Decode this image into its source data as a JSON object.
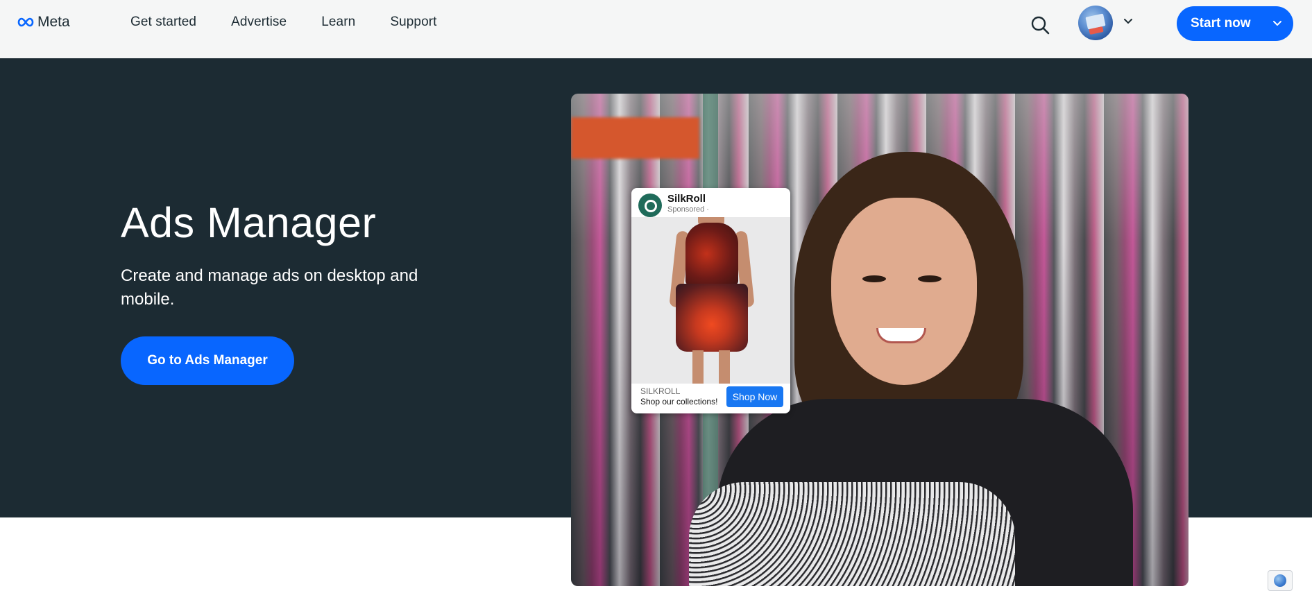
{
  "header": {
    "logo_text": "Meta",
    "nav": [
      "Get started",
      "Advertise",
      "Learn",
      "Support"
    ],
    "start_label": "Start now"
  },
  "hero": {
    "title": "Ads Manager",
    "subtitle": "Create and manage ads on desktop and mobile.",
    "cta_label": "Go to Ads Manager"
  },
  "ad_preview": {
    "brand": "SilkRoll",
    "sponsored": "Sponsored · ",
    "footer_brand": "SILKROLL",
    "footer_text": "Shop our collections!",
    "cta_label": "Shop Now"
  },
  "colors": {
    "accent": "#0866ff",
    "hero_bg": "#1c2b33",
    "header_bg": "#f5f6f6"
  },
  "icons": {
    "logo": "meta-infinity-icon",
    "search": "search-icon",
    "avatar_menu": "chevron-down-icon",
    "language": "globe-icon"
  }
}
